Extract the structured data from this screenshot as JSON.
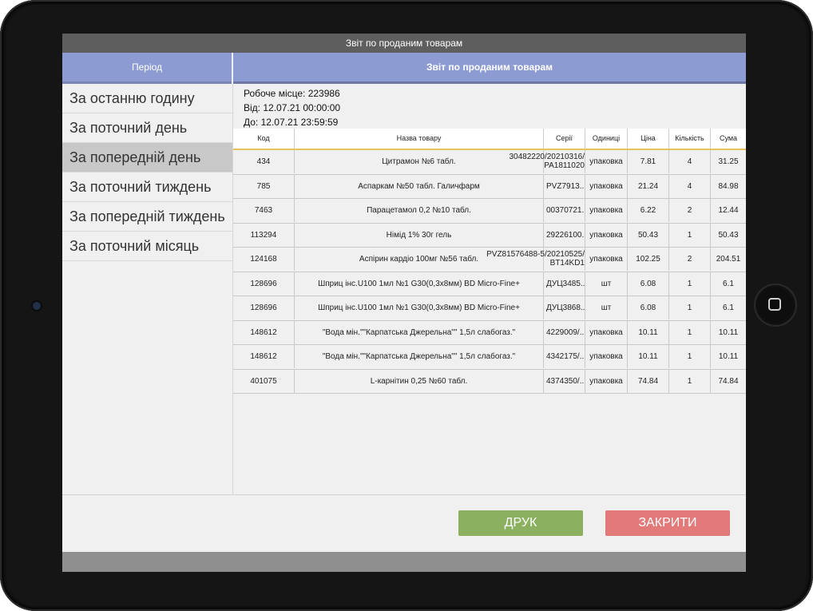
{
  "window": {
    "title": "Звіт по проданим товарам"
  },
  "left": {
    "header": "Період",
    "periods": [
      {
        "label": "За останню годину",
        "selected": false
      },
      {
        "label": "За поточний день",
        "selected": false
      },
      {
        "label": "За попередній день",
        "selected": true
      },
      {
        "label": "За поточний тиждень",
        "selected": false
      },
      {
        "label": "За попередній тиждень",
        "selected": false
      },
      {
        "label": "За поточний місяць",
        "selected": false
      }
    ]
  },
  "report": {
    "header": "Звіт по проданим товарам",
    "workplace": "Робоче місце: 223986",
    "from": "Від: 12.07.21 00:00:00",
    "to": "До: 12.07.21 23:59:59",
    "columns": [
      "Код",
      "Назва товару",
      "Серії",
      "Одиниці",
      "Ціна",
      "Кількість",
      "Сума"
    ],
    "rows": [
      {
        "code": "434",
        "name": "Цитрамон №6 табл.",
        "series": "30482220/20210316/\nPA1811020",
        "unit": "упаковка",
        "price": "7.81",
        "qty": "4",
        "sum": "31.25"
      },
      {
        "code": "785",
        "name": "Аспаркам №50 табл. Галичфарм",
        "series": "PVZ7913...",
        "unit": "упаковка",
        "price": "21.24",
        "qty": "4",
        "sum": "84.98"
      },
      {
        "code": "7463",
        "name": "Парацетамол 0,2 №10 табл.",
        "series": "00370721...",
        "unit": "упаковка",
        "price": "6.22",
        "qty": "2",
        "sum": "12.44"
      },
      {
        "code": "113294",
        "name": "Німід 1% 30г гель",
        "series": "29226100...",
        "unit": "упаковка",
        "price": "50.43",
        "qty": "1",
        "sum": "50.43"
      },
      {
        "code": "124168",
        "name": "Аспірин кардіо 100мг №56 табл.",
        "series": "PVZ81576488-5/20210525/\nBT14KD1",
        "unit": "упаковка",
        "price": "102.25",
        "qty": "2",
        "sum": "204.51"
      },
      {
        "code": "128696",
        "name": "Шприц інс.U100 1мл №1 G30(0,3х8мм) BD Micro-Fine+",
        "series": "ДУЦ3485...",
        "unit": "шт",
        "price": "6.08",
        "qty": "1",
        "sum": "6.1"
      },
      {
        "code": "128696",
        "name": "Шприц інс.U100 1мл №1 G30(0,3х8мм) BD Micro-Fine+",
        "series": "ДУЦ3868...",
        "unit": "шт",
        "price": "6.08",
        "qty": "1",
        "sum": "6.1"
      },
      {
        "code": "148612",
        "name": "\"Вода мін.\"\"Карпатська Джерельна\"\" 1,5л слабогаз.\"",
        "series": "4229009/...",
        "unit": "упаковка",
        "price": "10.11",
        "qty": "1",
        "sum": "10.11"
      },
      {
        "code": "148612",
        "name": "\"Вода мін.\"\"Карпатська Джерельна\"\" 1,5л слабогаз.\"",
        "series": "4342175/...",
        "unit": "упаковка",
        "price": "10.11",
        "qty": "1",
        "sum": "10.11"
      },
      {
        "code": "401075",
        "name": "L-карнітин 0,25 №60 табл.",
        "series": "4374350/...",
        "unit": "упаковка",
        "price": "74.84",
        "qty": "1",
        "sum": "74.84"
      }
    ]
  },
  "buttons": {
    "print": "ДРУК",
    "close": "ЗАКРИТИ"
  },
  "colors": {
    "header_bg": "#8d9bd3",
    "print_bg": "#8bb05f",
    "close_bg": "#e27a7a",
    "selected_bg": "#c8c8c8"
  }
}
